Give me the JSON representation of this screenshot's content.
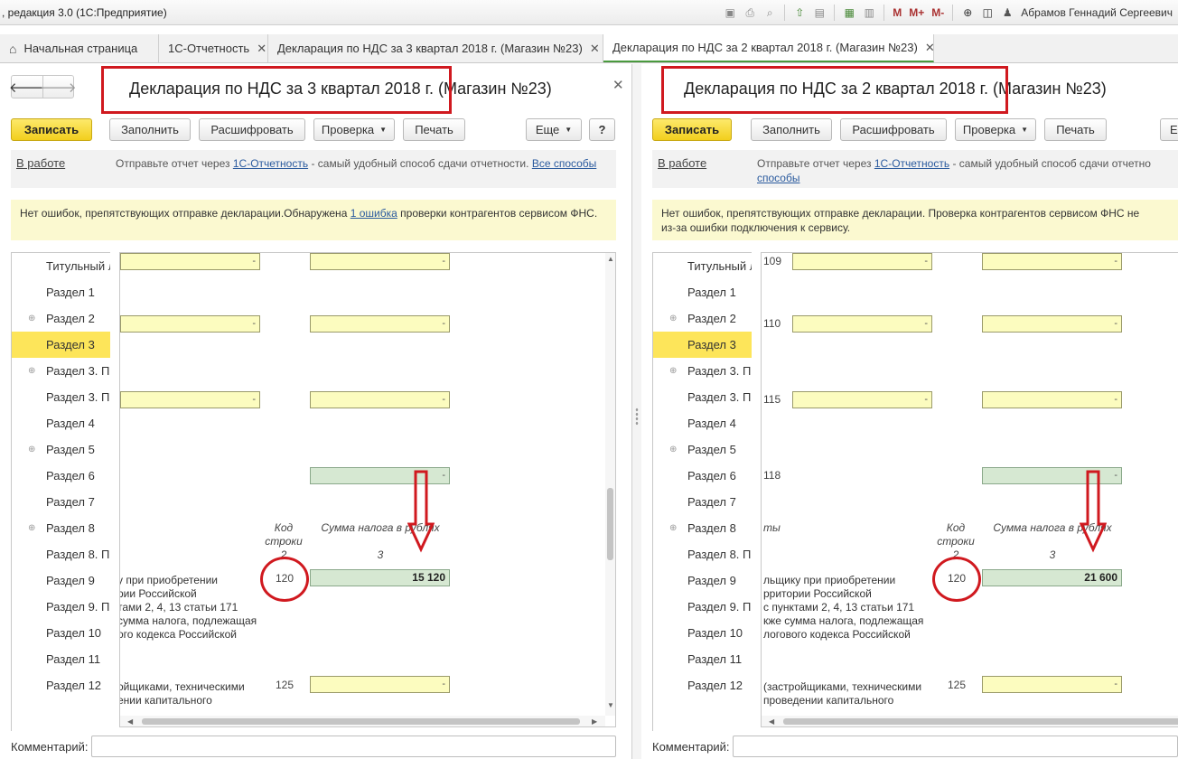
{
  "titlebar": {
    "app_title": ", редакция 3.0  (1С:Предприятие)",
    "m_labels": [
      "M",
      "M+",
      "M-"
    ],
    "user": "Абрамов Геннадий Сергеевич"
  },
  "tabs": [
    {
      "label": "Начальная страница",
      "has_close": false
    },
    {
      "label": "1С-Отчетность",
      "has_close": true
    },
    {
      "label": "Декларация по НДС за 3 квартал 2018 г. (Магазин №23)",
      "has_close": true
    },
    {
      "label": "Декларация по НДС за 2 квартал 2018 г. (Магазин №23)",
      "has_close": true
    }
  ],
  "left": {
    "title": "Декларация по НДС за 3 квартал 2018 г. (Магазин №23)",
    "buttons": {
      "save": "Записать",
      "fill": "Заполнить",
      "decode": "Расшифровать",
      "check": "Проверка",
      "print": "Печать",
      "more": "Еще",
      "help": "?"
    },
    "status_link": "В работе",
    "info_prefix": "Отправьте отчет через",
    "info_link1": "1С-Отчетность",
    "info_middle": "- самый удобный способ сдачи отчетности.",
    "info_link2": "Все способы",
    "warn_prefix": "Нет ошибок, препятствующих отправке декларации.Обнаружена",
    "warn_link": "1 ошибка",
    "warn_suffix": "проверки контрагентов сервисом ФНС.",
    "tree": [
      "Титульный л",
      "Раздел 1",
      "Раздел 2",
      "Раздел 3",
      "Раздел 3. П",
      "Раздел 3. П",
      "Раздел 4",
      "Раздел 5",
      "Раздел 6",
      "Раздел 7",
      "Раздел 8",
      "Раздел 8. П",
      "Раздел 9",
      "Раздел 9. П",
      "Раздел 10",
      "Раздел 11",
      "Раздел 12"
    ],
    "fields_dash": "-",
    "head_code": "Код строки",
    "head_sum": "Сумма налога в рублях",
    "col2": "2",
    "col3": "3",
    "row120_code": "120",
    "row120_value": "15 120",
    "row120_text": [
      "у при приобретении",
      "рии Российской",
      "тами 2, 4, 13 статьи 171",
      "сумма налога, подлежащая",
      "ого кодекса Российской"
    ],
    "row125_code": "125",
    "row125_text": [
      "ойщиками, техническими",
      "ении капитального"
    ],
    "comment_label": "Комментарий:"
  },
  "right": {
    "title": "Декларация по НДС за 2 квартал 2018 г. (Магазин №23)",
    "buttons": {
      "save": "Записать",
      "fill": "Заполнить",
      "decode": "Расшифровать",
      "check": "Проверка",
      "print": "Печать",
      "more": "Е"
    },
    "status_link": "В работе",
    "info_prefix": "Отправьте отчет через",
    "info_link1": "1С-Отчетность",
    "info_middle": "- самый удобный способ сдачи отчетно",
    "info_link2": "способы",
    "warn_line1": "Нет ошибок, препятствующих отправке декларации. Проверка контрагентов сервисом ФНС не",
    "warn_line2": "из-за ошибки подключения к сервису.",
    "tree": [
      "Титульный л",
      "Раздел 1",
      "Раздел 2",
      "Раздел 3",
      "Раздел 3. П",
      "Раздел 3. П",
      "Раздел 4",
      "Раздел 5",
      "Раздел 6",
      "Раздел 7",
      "Раздел 8",
      "Раздел 8. П",
      "Раздел 9",
      "Раздел 9. П",
      "Раздел 10",
      "Раздел 11",
      "Раздел 12"
    ],
    "line_codes": [
      "109",
      "110",
      "115",
      "118"
    ],
    "fields_dash": "-",
    "head_code": "Код строки",
    "head_sum": "Сумма налога в рублях",
    "head_left": "ты",
    "col2": "2",
    "col3": "3",
    "row120_code": "120",
    "row120_value": "21 600",
    "row120_text": [
      "льщику при приобретении",
      "рритории Российской",
      "с пунктами 2, 4, 13 статьи 171",
      "кже сумма налога, подлежащая",
      "логового кодекса Российской"
    ],
    "row125_code": "125",
    "row125_text": [
      "(застройщиками, техническими",
      "проведении капитального"
    ],
    "comment_label": "Комментарий:"
  },
  "colors": {
    "accent_yellow": "#f2cf1d",
    "annotation_red": "#d0191f",
    "field_yellow": "#fcfcbf",
    "field_green": "#d6e8d2"
  }
}
